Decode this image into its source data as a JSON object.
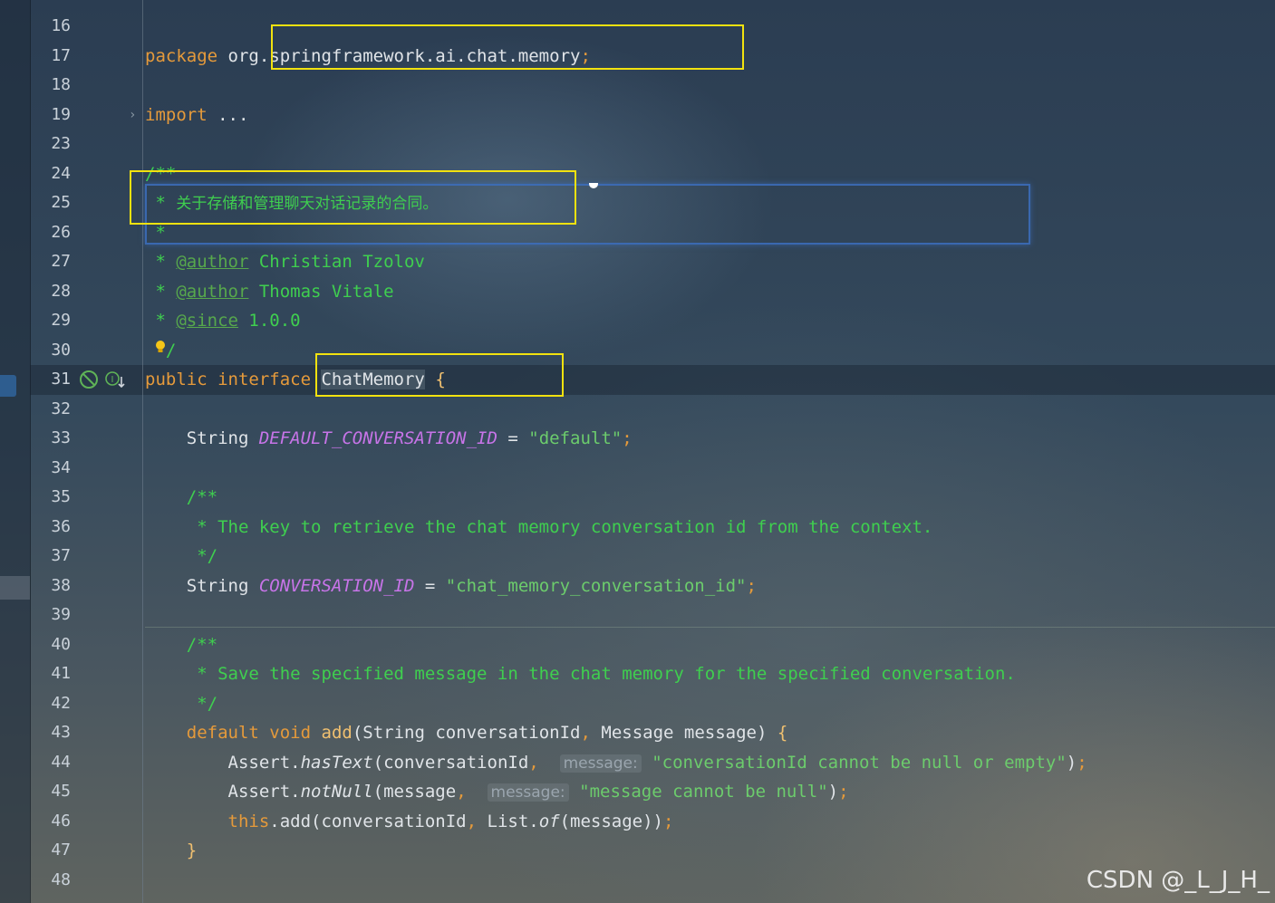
{
  "editor": {
    "lines": [
      {
        "n": "16",
        "html": ""
      },
      {
        "n": "17",
        "html": "<span class=\"kw\">package</span> org.springframework.ai.chat.memory<span class=\"punc\">;</span>"
      },
      {
        "n": "18",
        "html": ""
      },
      {
        "n": "19",
        "html": "<span class=\"kw\">import</span> ..."
      },
      {
        "n": "23",
        "html": ""
      },
      {
        "n": "24",
        "html": "<span class=\"cmt\">/**</span>"
      },
      {
        "n": "25",
        "html": "<span class=\"cmt\"> * </span><span class=\"cmt-cn\">关于存储和管理聊天对话记录的合同。</span>"
      },
      {
        "n": "26",
        "html": "<span class=\"cmt\"> *</span>"
      },
      {
        "n": "27",
        "html": "<span class=\"cmt\"> * </span><span class=\"tag\">@author</span><span class=\"cmt\"> Christian Tzolov</span>"
      },
      {
        "n": "28",
        "html": "<span class=\"cmt\"> * </span><span class=\"tag\">@author</span><span class=\"cmt\"> Thomas Vitale</span>"
      },
      {
        "n": "29",
        "html": "<span class=\"cmt\"> * </span><span class=\"tag\">@since</span><span class=\"cmt\"> 1.0.0</span>"
      },
      {
        "n": "30",
        "html": "<span class=\"cmt\">  /</span>"
      },
      {
        "n": "31",
        "html": "<span class=\"kw\">public interface</span> <span class=\"word-hl\">ChatMemory</span> <span class=\"fn\">{</span>"
      },
      {
        "n": "32",
        "html": ""
      },
      {
        "n": "33",
        "html": "    String <span class=\"const\">DEFAULT_CONVERSATION_ID</span> = <span class=\"str\">\"default\"</span><span class=\"punc\">;</span>"
      },
      {
        "n": "34",
        "html": ""
      },
      {
        "n": "35",
        "html": "<span class=\"cmt\">    /**</span>"
      },
      {
        "n": "36",
        "html": "<span class=\"cmt\">     * The key to retrieve the chat memory conversation id from the context.</span>"
      },
      {
        "n": "37",
        "html": "<span class=\"cmt\">     */</span>"
      },
      {
        "n": "38",
        "html": "    String <span class=\"const\">CONVERSATION_ID</span> = <span class=\"str\">\"chat_memory_conversation_id\"</span><span class=\"punc\">;</span>"
      },
      {
        "n": "39",
        "html": ""
      },
      {
        "n": "40",
        "html": "<span class=\"cmt\">    /**</span>"
      },
      {
        "n": "41",
        "html": "<span class=\"cmt\">     * Save the specified message in the chat memory for the specified conversation.</span>"
      },
      {
        "n": "42",
        "html": "<span class=\"cmt\">     */</span>"
      },
      {
        "n": "43",
        "html": "    <span class=\"kw\">default void</span> <span class=\"fn\">add</span>(String conversationId<span class=\"punc\">,</span> Message message) <span class=\"fn\">{</span>"
      },
      {
        "n": "44",
        "html": "        Assert.<span class=\"ital\">hasText</span>(conversationId<span class=\"punc\">,</span>  <span class=\"hint\">message:</span> <span class=\"str\">\"conversationId cannot be null or empty\"</span>)<span class=\"punc\">;</span>"
      },
      {
        "n": "45",
        "html": "        Assert.<span class=\"ital\">notNull</span>(message<span class=\"punc\">,</span>  <span class=\"hint\">message:</span> <span class=\"str\">\"message cannot be null\"</span>)<span class=\"punc\">;</span>"
      },
      {
        "n": "46",
        "html": "        <span class=\"kw\">this</span>.add(conversationId<span class=\"punc\">,</span> List.<span class=\"ital\">of</span>(message))<span class=\"punc\">;</span>"
      },
      {
        "n": "47",
        "html": "    <span class=\"fn\">}</span>"
      },
      {
        "n": "48",
        "html": ""
      }
    ]
  },
  "watermark": "CSDN @_L_J_H_"
}
